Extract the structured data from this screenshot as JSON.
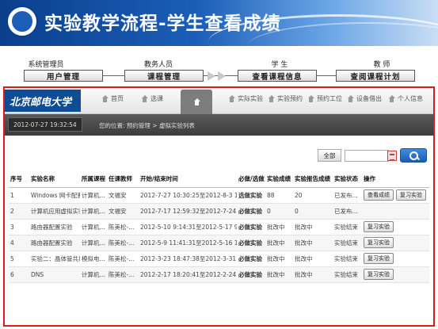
{
  "slide": {
    "title": "实验教学流程-学生查看成绩"
  },
  "flow": [
    {
      "role": "系统管理员",
      "step": "用户管理"
    },
    {
      "role": "教务人员",
      "step": "课程管理"
    },
    {
      "role": "学  生",
      "step": "查看课程信息"
    },
    {
      "role": "教  师",
      "step": "查阅课程计划"
    }
  ],
  "app": {
    "logo_text": "北京邮电大学",
    "nav": [
      "首页",
      "选课",
      "",
      "实际实验",
      "实验预约",
      "预约工位",
      "设备借出",
      "个人信息"
    ],
    "datetime": "2012-07-27  19:32:54",
    "location": "您的位置: 预约管理 > 虚拟实验列表"
  },
  "search": {
    "select_all": "全部"
  },
  "table": {
    "headers": [
      "序号",
      "实验名称",
      "所属课程",
      "任课教师",
      "开始/结束时间",
      "必做/选做",
      "实验成绩",
      "实验报告成绩",
      "实验状态",
      "操作"
    ],
    "rows": [
      {
        "no": "1",
        "name": "Windows 网卡配置...",
        "course": "计算机...",
        "teacher": "文福安",
        "time": "2012-7-27 10:30:25至2012-8-3 10:3...",
        "type": "选做实验",
        "score": "88",
        "report": "20",
        "status": "已发布...",
        "ops": [
          "查看成绩",
          "复习实验"
        ]
      },
      {
        "no": "2",
        "name": "计算机应用虚拟实验",
        "course": "计算机...",
        "teacher": "文福安",
        "time": "2012-7-17 12:59:32至2012-7-24 12:...",
        "type": "必做实验",
        "score": "0",
        "report": "0",
        "status": "已发布...",
        "ops": []
      },
      {
        "no": "3",
        "name": "路由器配置实验",
        "course": "计算机...",
        "teacher": "陈美松-...",
        "time": "2012-5-10 9:14:31至2012-5-17 9:14...",
        "type": "必做实验",
        "score": "批改中",
        "report": "批改中",
        "status": "实验结束",
        "ops": [
          "复习实验"
        ]
      },
      {
        "no": "4",
        "name": "路由器配置实验",
        "course": "计算机...",
        "teacher": "陈美松-...",
        "time": "2012-5-9 11:41:31至2012-5-16 11:4...",
        "type": "必做实验",
        "score": "批改中",
        "report": "批改中",
        "status": "实验结束",
        "ops": [
          "复习实验"
        ]
      },
      {
        "no": "5",
        "name": "实验二：晶体管共射...",
        "course": "模拟电...",
        "teacher": "陈美松-...",
        "time": "2012-3-23 18:47:38至2012-3-31 18:...",
        "type": "必做实验",
        "score": "批改中",
        "report": "批改中",
        "status": "实验结束",
        "ops": [
          "复习实验"
        ]
      },
      {
        "no": "6",
        "name": "DNS",
        "course": "计算机...",
        "teacher": "陈美松-...",
        "time": "2012-2-17 18:20:41至2012-2-24 16:...",
        "type": "必做实验",
        "score": "批改中",
        "report": "批改中",
        "status": "实验结束",
        "ops": [
          "复习实验"
        ]
      }
    ]
  },
  "colors": {
    "banner_dark": "#0a3f8c",
    "highlight_border": "#d81b1b",
    "search_button": "#1a5fb4"
  }
}
